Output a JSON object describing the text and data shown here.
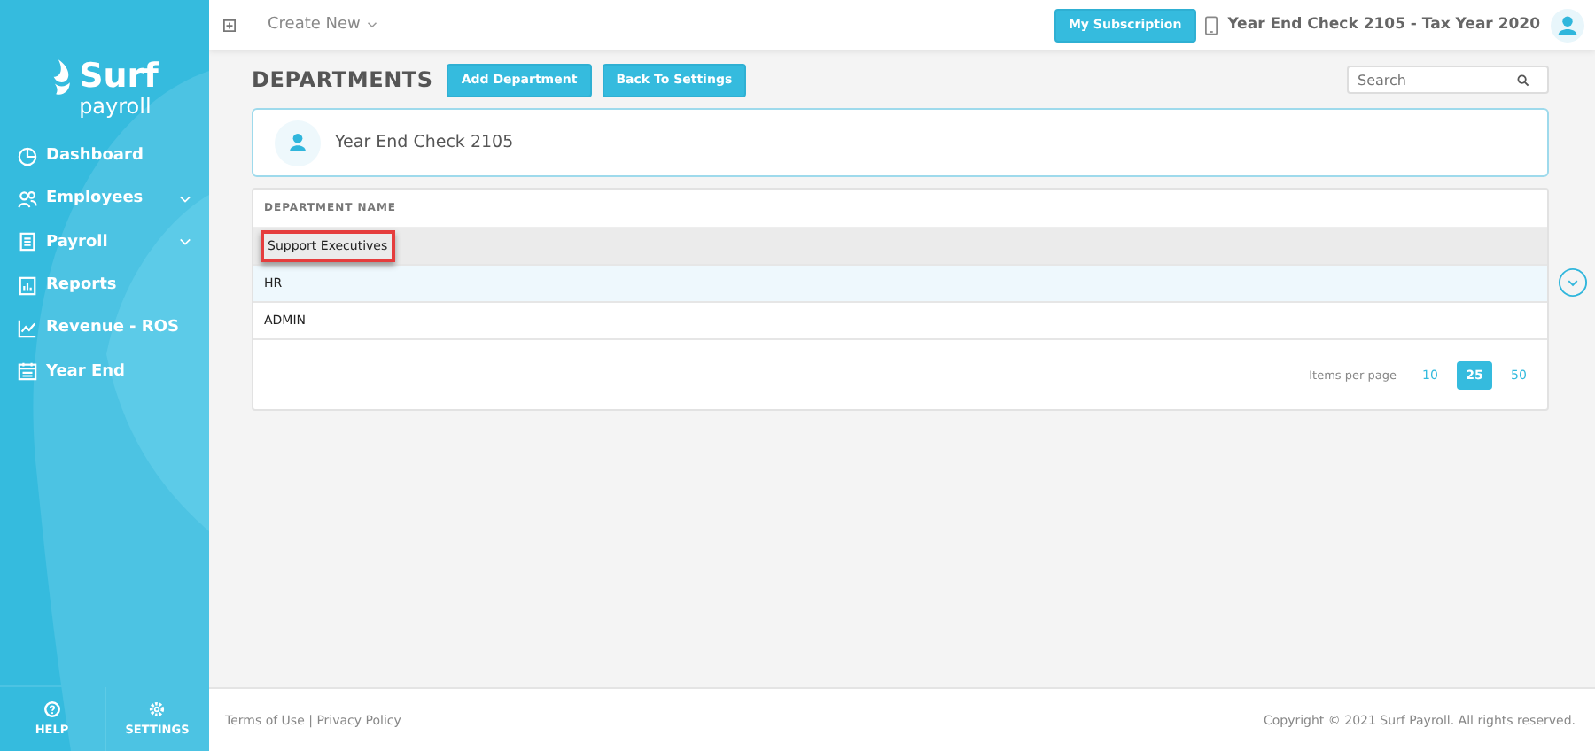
{
  "brand": {
    "name": "Surf",
    "sub": "payroll"
  },
  "sidebar": {
    "items": [
      {
        "label": "Dashboard",
        "expandable": false
      },
      {
        "label": "Employees",
        "expandable": true
      },
      {
        "label": "Payroll",
        "expandable": true
      },
      {
        "label": "Reports",
        "expandable": false
      },
      {
        "label": "Revenue - ROS",
        "expandable": false
      },
      {
        "label": "Year End",
        "expandable": false
      }
    ],
    "bottom": [
      {
        "label": "HELP"
      },
      {
        "label": "SETTINGS"
      }
    ]
  },
  "topbar": {
    "create_new": "Create New",
    "subscription_button": "My Subscription",
    "company": "Year End Check 2105 - Tax Year 2020"
  },
  "page": {
    "title": "DEPARTMENTS",
    "buttons": [
      "Add Department",
      "Back To Settings"
    ],
    "search": {
      "placeholder": "Search"
    }
  },
  "company_card": {
    "name": "Year End Check 2105"
  },
  "table": {
    "columns": [
      "DEPARTMENT NAME"
    ],
    "rows": [
      {
        "name": "Support Executives",
        "selected": true,
        "hovered": false,
        "outlined": true
      },
      {
        "name": "HR",
        "selected": false,
        "hovered": true,
        "outlined": false
      },
      {
        "name": "ADMIN",
        "selected": false,
        "hovered": false,
        "outlined": false
      }
    ]
  },
  "pagination": {
    "label": "Items per page",
    "options": [
      {
        "label": "10",
        "selected": false
      },
      {
        "label": "25",
        "selected": true
      },
      {
        "label": "50",
        "selected": false
      }
    ]
  },
  "footer": {
    "links": "Terms of Use | Privacy Policy",
    "copyright": "Copyright © 2021 Surf Payroll. All rights reserved."
  }
}
